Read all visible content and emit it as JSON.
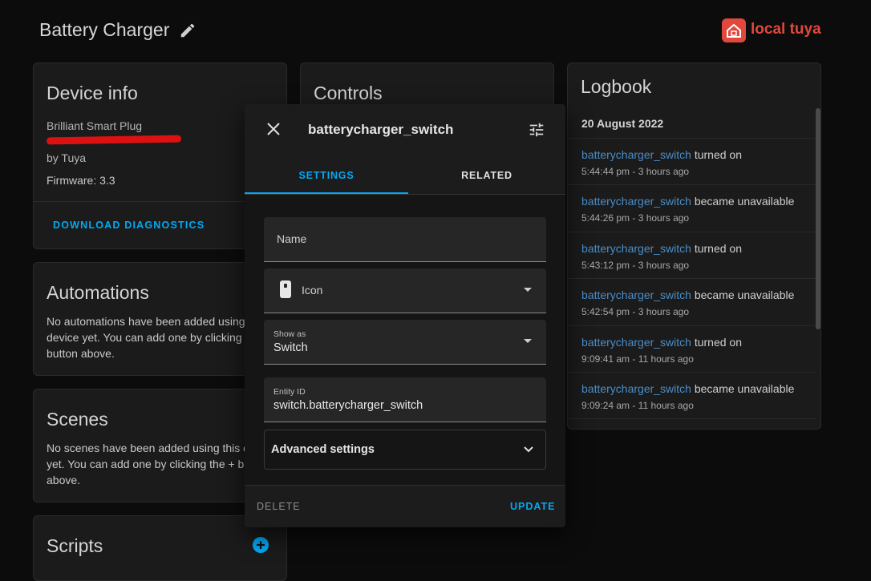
{
  "header": {
    "title": "Battery Charger",
    "edit_icon": "pencil-icon"
  },
  "brand": {
    "logo_text": "local tuya",
    "color": "#e2473d"
  },
  "device_info": {
    "title": "Device info",
    "model": "Brilliant Smart Plug",
    "manufacturer": "by Tuya",
    "firmware": "Firmware: 3.3",
    "download_label": "DOWNLOAD DIAGNOSTICS"
  },
  "controls": {
    "title": "Controls"
  },
  "automations": {
    "title": "Automations",
    "lines": [
      "No automations have been added using",
      "device yet. You can add one by clicking t",
      "button above."
    ]
  },
  "scenes": {
    "title": "Scenes",
    "lines": [
      "No scenes have been added using this d",
      "yet. You can add one by clicking the + bu",
      "above."
    ]
  },
  "scripts": {
    "title": "Scripts"
  },
  "logbook": {
    "title": "Logbook",
    "date": "20 August 2022",
    "entries": [
      {
        "entity": "batterycharger_switch",
        "action": " turned on",
        "time": "5:44:44 pm - 3 hours ago"
      },
      {
        "entity": "batterycharger_switch",
        "action": " became unavailable",
        "time": "5:44:26 pm - 3 hours ago"
      },
      {
        "entity": "batterycharger_switch",
        "action": " turned on",
        "time": "5:43:12 pm - 3 hours ago"
      },
      {
        "entity": "batterycharger_switch",
        "action": " became unavailable",
        "time": "5:42:54 pm - 3 hours ago"
      },
      {
        "entity": "batterycharger_switch",
        "action": " turned on",
        "time": "9:09:41 am - 11 hours ago"
      },
      {
        "entity": "batterycharger_switch",
        "action": " became unavailable",
        "time": "9:09:24 am - 11 hours ago"
      }
    ]
  },
  "dialog": {
    "title": "batterycharger_switch",
    "tabs": [
      "SETTINGS",
      "RELATED"
    ],
    "name_label": "Name",
    "icon_label": "Icon",
    "show_as_label": "Show as",
    "show_as_value": "Switch",
    "entity_id_label": "Entity ID",
    "entity_id_value": "switch.batterycharger_switch",
    "advanced_label": "Advanced settings",
    "delete_label": "DELETE",
    "update_label": "UPDATE"
  },
  "colors": {
    "accent": "#03a9f4",
    "background": "#0c0c0c",
    "card": "#1b1b1b"
  }
}
